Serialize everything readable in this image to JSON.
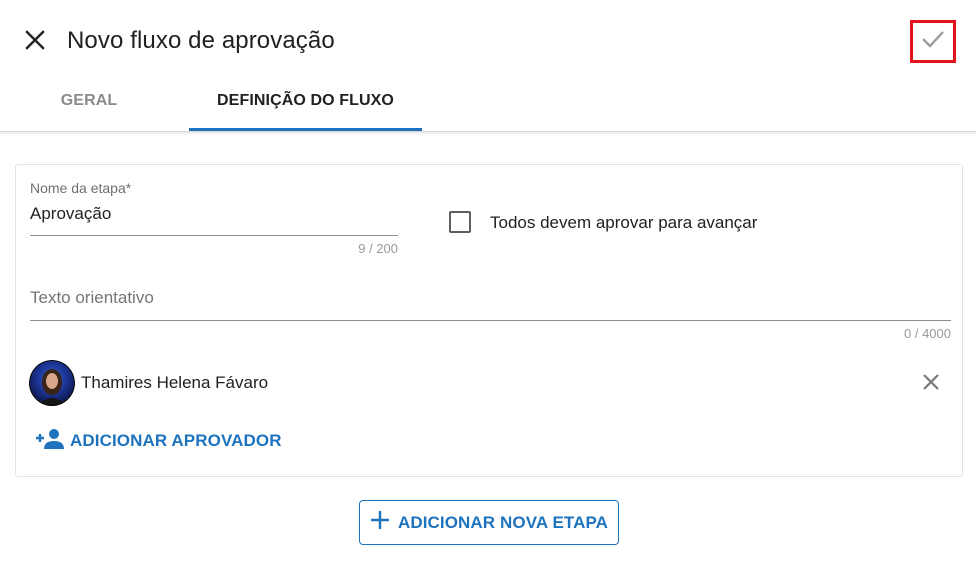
{
  "header": {
    "title": "Novo fluxo de aprovação",
    "close_icon": "close-icon",
    "confirm_icon": "check-icon"
  },
  "tabs": [
    {
      "label": "GERAL",
      "active": false
    },
    {
      "label": "DEFINIÇÃO DO FLUXO",
      "active": true
    }
  ],
  "stage": {
    "name_label": "Nome da etapa*",
    "name_value": "Aprovação",
    "name_counter": "9 / 200",
    "all_must_approve_label": "Todos devem aprovar para avançar",
    "all_must_approve_checked": false,
    "guidance_placeholder": "Texto orientativo",
    "guidance_counter": "0 / 4000",
    "approvers": [
      {
        "name": "Thamires Helena Fávaro",
        "avatar": "user-photo"
      }
    ],
    "add_approver_label": "ADICIONAR APROVADOR",
    "add_approver_icon": "person-add-icon"
  },
  "add_stage": {
    "label": "ADICIONAR NOVA ETAPA",
    "icon": "plus-icon"
  },
  "colors": {
    "accent": "#1e73be",
    "highlight_border": "#e3131b",
    "text": "#212121",
    "muted": "#8a8a8a"
  }
}
